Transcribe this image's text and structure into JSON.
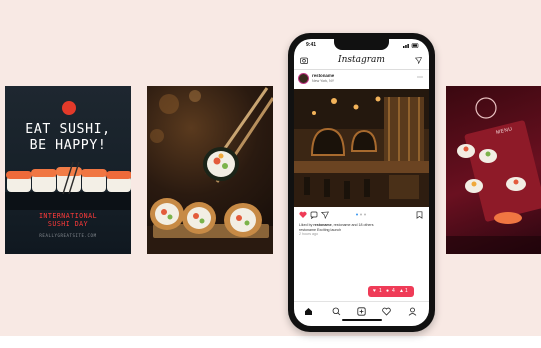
{
  "cards": {
    "sushi_poster": {
      "headline_line1": "EAT SUSHI,",
      "headline_line2": "BE HAPPY!",
      "sub_line1": "INTERNATIONAL",
      "sub_line2": "SUSHI DAY",
      "url": "REALLYGREATSITE.COM"
    },
    "menu_card": {
      "label": "MENU"
    }
  },
  "phone": {
    "status": {
      "time": "9:41"
    },
    "header": {
      "app_name": "Instagram"
    },
    "post": {
      "username": "restoname",
      "location": "New York, NY",
      "caption_liked_by": "Liked by",
      "caption_user": "restoname",
      "caption_rest": ", restoname and 18 others",
      "caption_line2": "restoname Exciting launch",
      "caption_meta": "2 hours ago",
      "notification": {
        "likes": "1",
        "comments": "4",
        "follows": "1"
      }
    }
  },
  "colors": {
    "background": "#f8e9e4",
    "poster_red": "#ff3a3a",
    "like_red": "#ef3b57",
    "phone_body": "#111111"
  }
}
